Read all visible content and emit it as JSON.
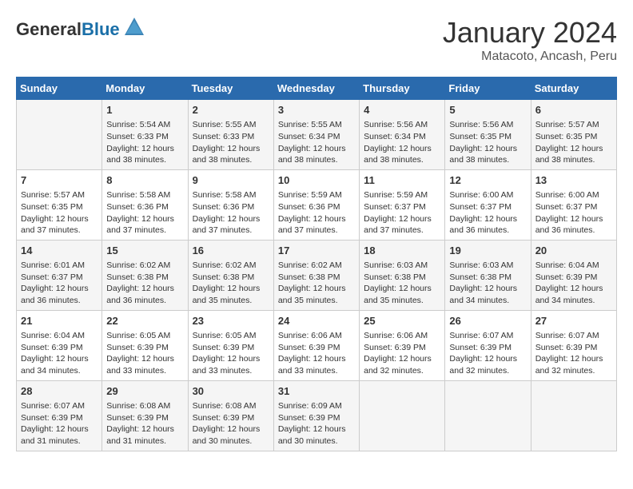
{
  "header": {
    "logo_line1": "General",
    "logo_line2": "Blue",
    "month": "January 2024",
    "location": "Matacoto, Ancash, Peru"
  },
  "days_of_week": [
    "Sunday",
    "Monday",
    "Tuesday",
    "Wednesday",
    "Thursday",
    "Friday",
    "Saturday"
  ],
  "weeks": [
    [
      {
        "day": "",
        "info": ""
      },
      {
        "day": "1",
        "info": "Sunrise: 5:54 AM\nSunset: 6:33 PM\nDaylight: 12 hours\nand 38 minutes."
      },
      {
        "day": "2",
        "info": "Sunrise: 5:55 AM\nSunset: 6:33 PM\nDaylight: 12 hours\nand 38 minutes."
      },
      {
        "day": "3",
        "info": "Sunrise: 5:55 AM\nSunset: 6:34 PM\nDaylight: 12 hours\nand 38 minutes."
      },
      {
        "day": "4",
        "info": "Sunrise: 5:56 AM\nSunset: 6:34 PM\nDaylight: 12 hours\nand 38 minutes."
      },
      {
        "day": "5",
        "info": "Sunrise: 5:56 AM\nSunset: 6:35 PM\nDaylight: 12 hours\nand 38 minutes."
      },
      {
        "day": "6",
        "info": "Sunrise: 5:57 AM\nSunset: 6:35 PM\nDaylight: 12 hours\nand 38 minutes."
      }
    ],
    [
      {
        "day": "7",
        "info": "Sunrise: 5:57 AM\nSunset: 6:35 PM\nDaylight: 12 hours\nand 37 minutes."
      },
      {
        "day": "8",
        "info": "Sunrise: 5:58 AM\nSunset: 6:36 PM\nDaylight: 12 hours\nand 37 minutes."
      },
      {
        "day": "9",
        "info": "Sunrise: 5:58 AM\nSunset: 6:36 PM\nDaylight: 12 hours\nand 37 minutes."
      },
      {
        "day": "10",
        "info": "Sunrise: 5:59 AM\nSunset: 6:36 PM\nDaylight: 12 hours\nand 37 minutes."
      },
      {
        "day": "11",
        "info": "Sunrise: 5:59 AM\nSunset: 6:37 PM\nDaylight: 12 hours\nand 37 minutes."
      },
      {
        "day": "12",
        "info": "Sunrise: 6:00 AM\nSunset: 6:37 PM\nDaylight: 12 hours\nand 36 minutes."
      },
      {
        "day": "13",
        "info": "Sunrise: 6:00 AM\nSunset: 6:37 PM\nDaylight: 12 hours\nand 36 minutes."
      }
    ],
    [
      {
        "day": "14",
        "info": "Sunrise: 6:01 AM\nSunset: 6:37 PM\nDaylight: 12 hours\nand 36 minutes."
      },
      {
        "day": "15",
        "info": "Sunrise: 6:02 AM\nSunset: 6:38 PM\nDaylight: 12 hours\nand 36 minutes."
      },
      {
        "day": "16",
        "info": "Sunrise: 6:02 AM\nSunset: 6:38 PM\nDaylight: 12 hours\nand 35 minutes."
      },
      {
        "day": "17",
        "info": "Sunrise: 6:02 AM\nSunset: 6:38 PM\nDaylight: 12 hours\nand 35 minutes."
      },
      {
        "day": "18",
        "info": "Sunrise: 6:03 AM\nSunset: 6:38 PM\nDaylight: 12 hours\nand 35 minutes."
      },
      {
        "day": "19",
        "info": "Sunrise: 6:03 AM\nSunset: 6:38 PM\nDaylight: 12 hours\nand 34 minutes."
      },
      {
        "day": "20",
        "info": "Sunrise: 6:04 AM\nSunset: 6:39 PM\nDaylight: 12 hours\nand 34 minutes."
      }
    ],
    [
      {
        "day": "21",
        "info": "Sunrise: 6:04 AM\nSunset: 6:39 PM\nDaylight: 12 hours\nand 34 minutes."
      },
      {
        "day": "22",
        "info": "Sunrise: 6:05 AM\nSunset: 6:39 PM\nDaylight: 12 hours\nand 33 minutes."
      },
      {
        "day": "23",
        "info": "Sunrise: 6:05 AM\nSunset: 6:39 PM\nDaylight: 12 hours\nand 33 minutes."
      },
      {
        "day": "24",
        "info": "Sunrise: 6:06 AM\nSunset: 6:39 PM\nDaylight: 12 hours\nand 33 minutes."
      },
      {
        "day": "25",
        "info": "Sunrise: 6:06 AM\nSunset: 6:39 PM\nDaylight: 12 hours\nand 32 minutes."
      },
      {
        "day": "26",
        "info": "Sunrise: 6:07 AM\nSunset: 6:39 PM\nDaylight: 12 hours\nand 32 minutes."
      },
      {
        "day": "27",
        "info": "Sunrise: 6:07 AM\nSunset: 6:39 PM\nDaylight: 12 hours\nand 32 minutes."
      }
    ],
    [
      {
        "day": "28",
        "info": "Sunrise: 6:07 AM\nSunset: 6:39 PM\nDaylight: 12 hours\nand 31 minutes."
      },
      {
        "day": "29",
        "info": "Sunrise: 6:08 AM\nSunset: 6:39 PM\nDaylight: 12 hours\nand 31 minutes."
      },
      {
        "day": "30",
        "info": "Sunrise: 6:08 AM\nSunset: 6:39 PM\nDaylight: 12 hours\nand 30 minutes."
      },
      {
        "day": "31",
        "info": "Sunrise: 6:09 AM\nSunset: 6:39 PM\nDaylight: 12 hours\nand 30 minutes."
      },
      {
        "day": "",
        "info": ""
      },
      {
        "day": "",
        "info": ""
      },
      {
        "day": "",
        "info": ""
      }
    ]
  ]
}
